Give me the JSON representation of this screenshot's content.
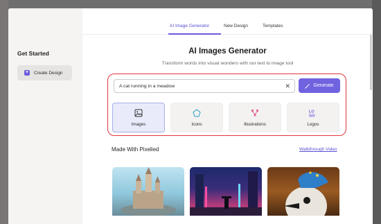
{
  "sidebar": {
    "title": "Get Started",
    "create_label": "Create Design"
  },
  "tabs": [
    {
      "label": "AI Image Generator",
      "active": true
    },
    {
      "label": "New Design",
      "active": false
    },
    {
      "label": "Templates",
      "active": false
    }
  ],
  "generator": {
    "title": "AI Images Generator",
    "subtitle": "Transform words into visual wonders with our text to image tool",
    "prompt_value": "A cat running in a meadow",
    "generate_label": "Generate"
  },
  "categories": [
    {
      "label": "Images",
      "icon": "image-icon",
      "selected": true
    },
    {
      "label": "Icons",
      "icon": "pentagon-icon",
      "selected": false
    },
    {
      "label": "Illustrations",
      "icon": "illustration-icon",
      "selected": false
    },
    {
      "label": "Logos",
      "icon": "logo-icon",
      "selected": false
    }
  ],
  "gallery": {
    "heading": "Made With Pixelied",
    "walkthrough_label": "Walkthrough Video"
  },
  "colors": {
    "accent": "#6f63e0",
    "highlight_border": "#e0343e"
  }
}
